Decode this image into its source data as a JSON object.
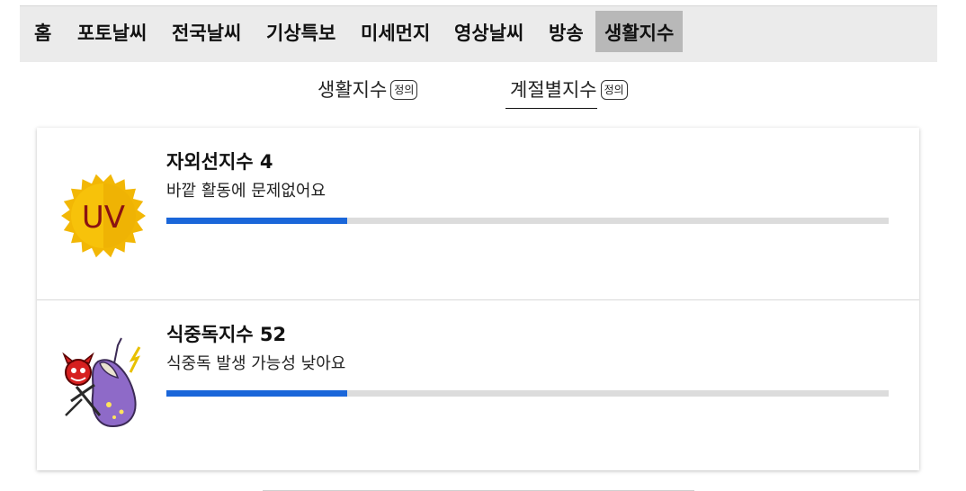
{
  "nav": {
    "items": [
      {
        "label": "홈"
      },
      {
        "label": "포토날씨"
      },
      {
        "label": "전국날씨"
      },
      {
        "label": "기상특보"
      },
      {
        "label": "미세먼지"
      },
      {
        "label": "영상날씨"
      },
      {
        "label": "방송"
      },
      {
        "label": "생활지수",
        "active": true
      }
    ]
  },
  "subtabs": [
    {
      "label": "생활지수",
      "def_label": "정의",
      "active": false
    },
    {
      "label": "계절별지수",
      "def_label": "정의",
      "active": true
    }
  ],
  "indices": [
    {
      "title": "자외선지수 4",
      "description": "바깥 활동에 문제없어요",
      "level_fraction": 0.25,
      "icon": "uv-sun-icon",
      "icon_text": "UV"
    },
    {
      "title": "식중독지수 52",
      "description": "식중독 발생 가능성 낮아요",
      "level_fraction": 0.25,
      "icon": "food-poisoning-germ-icon"
    }
  ],
  "colors": {
    "bar_fill": "#1a66d9",
    "bar_track": "#dcdcdc",
    "nav_bg": "#ebebeb",
    "nav_active_bg": "#b8b8b8"
  }
}
